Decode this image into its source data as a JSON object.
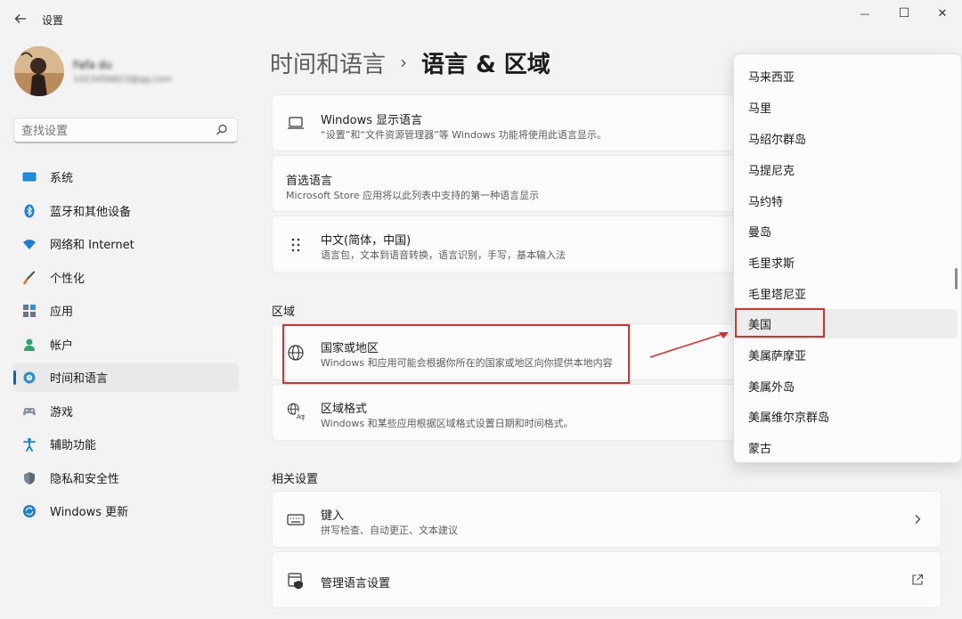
{
  "window": {
    "title": "设置",
    "back_icon": "arrow-left-icon",
    "minimize_glyph": "—",
    "maximize_glyph": "☐",
    "close_glyph": "✕"
  },
  "user": {
    "name": "Fafa du",
    "email": "1023456823@qq.com"
  },
  "search": {
    "placeholder": "查找设置"
  },
  "nav": [
    {
      "id": "system",
      "label": "系统",
      "icon": "monitor-icon"
    },
    {
      "id": "bluetooth",
      "label": "蓝牙和其他设备",
      "icon": "bluetooth-icon"
    },
    {
      "id": "network",
      "label": "网络和 Internet",
      "icon": "wifi-icon"
    },
    {
      "id": "personalization",
      "label": "个性化",
      "icon": "brush-icon"
    },
    {
      "id": "apps",
      "label": "应用",
      "icon": "apps-icon"
    },
    {
      "id": "accounts",
      "label": "帐户",
      "icon": "person-icon"
    },
    {
      "id": "time-language",
      "label": "时间和语言",
      "icon": "globe-clock-icon",
      "selected": true
    },
    {
      "id": "gaming",
      "label": "游戏",
      "icon": "gamepad-icon"
    },
    {
      "id": "accessibility",
      "label": "辅助功能",
      "icon": "accessibility-icon"
    },
    {
      "id": "privacy",
      "label": "隐私和安全性",
      "icon": "shield-icon"
    },
    {
      "id": "windows-update",
      "label": "Windows 更新",
      "icon": "update-icon"
    }
  ],
  "breadcrumb": {
    "parent": "时间和语言",
    "separator": "›",
    "current": "语言 & 区域"
  },
  "cards": {
    "display_language": {
      "title": "Windows 显示语言",
      "desc": "“设置”和“文件资源管理器”等 Windows 功能将使用此语言显示。",
      "icon": "laptop-icon"
    },
    "preferred_language": {
      "title": "首选语言",
      "desc": "Microsoft Store 应用将以此列表中支持的第一种语言显示"
    },
    "chinese": {
      "title": "中文(简体，中国)",
      "desc": "语言包，文本到语音转换，语言识别，手写，基本输入法",
      "icon": "drag-handle-icon"
    },
    "country_region": {
      "title": "国家或地区",
      "desc": "Windows 和应用可能会根据你所在的国家或地区向你提供本地内容",
      "icon": "globe-icon"
    },
    "regional_format": {
      "title": "区域格式",
      "desc": "Windows 和某些应用根据区域格式设置日期和时间格式。",
      "icon": "language-format-icon"
    },
    "typing": {
      "title": "键入",
      "desc": "拼写检查、自动更正、文本建议",
      "icon": "keyboard-icon",
      "trail_icon": "chevron-right-icon"
    },
    "admin_language": {
      "title": "管理语言设置",
      "icon": "admin-shield-icon",
      "trail_icon": "external-link-icon"
    }
  },
  "sections": {
    "region": "区域",
    "related": "相关设置"
  },
  "dropdown": {
    "options": [
      "马来西亚",
      "马里",
      "马绍尔群岛",
      "马提尼克",
      "马约特",
      "曼岛",
      "毛里求斯",
      "毛里塔尼亚",
      "美国",
      "美属萨摩亚",
      "美属外岛",
      "美属维尔京群岛",
      "蒙古"
    ],
    "highlighted": "美国"
  },
  "colors": {
    "accent": "#0067c0",
    "annotation_red": "#d9302c"
  }
}
